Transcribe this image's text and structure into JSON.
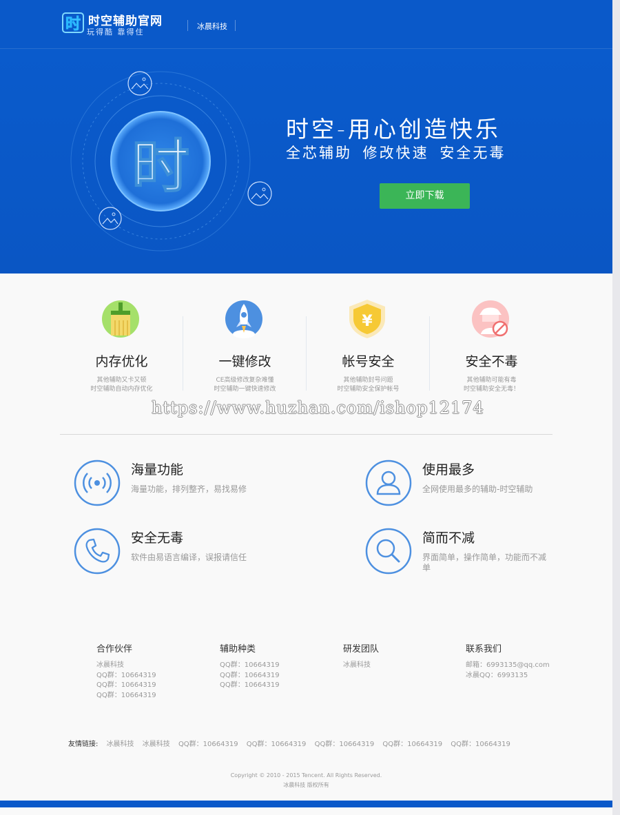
{
  "header": {
    "brand_title": "时空辅助官网",
    "brand_slogan": "玩得酷  靠得住",
    "nav": [
      "冰晨科技"
    ]
  },
  "hero": {
    "emblem_char": "时",
    "title": "时空-用心创造快乐",
    "subtitle": "全芯辅助 修改快速 安全无毒",
    "download_label": "立即下载"
  },
  "features": [
    {
      "icon": "broom-icon",
      "title": "内存优化",
      "desc1": "其他辅助又卡又顿",
      "desc2": "时空辅助自动内存优化"
    },
    {
      "icon": "rocket-icon",
      "title": "一键修改",
      "desc1": "CE高级修改复杂难懂",
      "desc2": "时空辅助一键快速修改"
    },
    {
      "icon": "shield-yen-icon",
      "title": "帐号安全",
      "desc1": "其他辅助封号问题",
      "desc2": "时空辅助安全保护帐号"
    },
    {
      "icon": "virus-block-icon",
      "title": "安全不毒",
      "desc1": "其他辅助可能有毒",
      "desc2": "时空辅助安全无毒！"
    }
  ],
  "watermark": "https://www.huzhan.com/ishop12174",
  "points": [
    {
      "icon": "signal-icon",
      "title": "海量功能",
      "desc": "海量功能，排列整齐，易找易修"
    },
    {
      "icon": "user-icon",
      "title": "使用最多",
      "desc": "全网使用最多的辅助-时空辅助"
    },
    {
      "icon": "phone-icon",
      "title": "安全无毒",
      "desc": "软件由易语言编译，误报请信任"
    },
    {
      "icon": "search-icon",
      "title": "简而不减",
      "desc": "界面简单，操作简单，功能而不减单"
    }
  ],
  "footer": {
    "columns": [
      {
        "title": "合作伙伴",
        "items": [
          "冰晨科技",
          "QQ群：10664319",
          "QQ群：10664319",
          "QQ群：10664319"
        ]
      },
      {
        "title": "辅助种类",
        "items": [
          "QQ群：10664319",
          "QQ群：10664319",
          "QQ群：10664319"
        ]
      },
      {
        "title": "研发团队",
        "items": [
          "冰晨科技"
        ]
      },
      {
        "title": "联系我们",
        "items": [
          "邮箱：6993135@qq.com",
          "冰晨QQ：6993135"
        ]
      }
    ],
    "links_label": "友情链接:",
    "links": [
      "冰晨科技",
      "冰晨科技",
      "QQ群：10664319",
      "QQ群：10664319",
      "QQ群：10664319",
      "QQ群：10664319",
      "QQ群：10664319"
    ],
    "copyright": "Copyright © 2010 - 2015 Tencent. All Rights Reserved.",
    "owner": "冰晨科技 版权所有"
  },
  "colors": {
    "brand_blue": "#0a59c9",
    "download_green": "#3bb557",
    "icon_blue": "#4d90e0"
  }
}
